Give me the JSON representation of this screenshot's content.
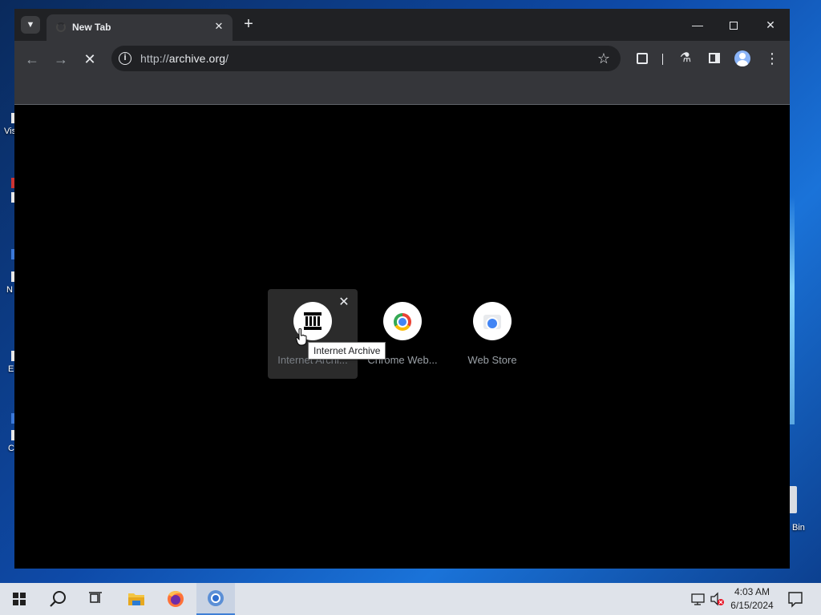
{
  "desktop": {
    "icons": [
      {
        "label": "Vis"
      },
      {
        "label": "N"
      },
      {
        "label": "E"
      },
      {
        "label": "C"
      }
    ],
    "recycle_bin_label": "Bin"
  },
  "browser": {
    "tab_title": "New Tab",
    "address": {
      "scheme": "http://",
      "host": "archive.org",
      "path": "/"
    },
    "colors": {
      "frame": "#202124",
      "toolbar": "#35363a",
      "content": "#000000"
    }
  },
  "shortcuts": [
    {
      "label": "Internet Archi...",
      "icon": "internet-archive-icon"
    },
    {
      "label": "Chrome Web...",
      "icon": "chrome-web-store-icon"
    },
    {
      "label": "Web Store",
      "icon": "web-store-icon"
    }
  ],
  "tooltip": "Internet Archive",
  "taskbar": {
    "apps": [
      "start",
      "search",
      "task-view",
      "file-explorer",
      "firefox",
      "chrome"
    ],
    "clock": {
      "time": "4:03 AM",
      "date": "6/15/2024"
    }
  }
}
